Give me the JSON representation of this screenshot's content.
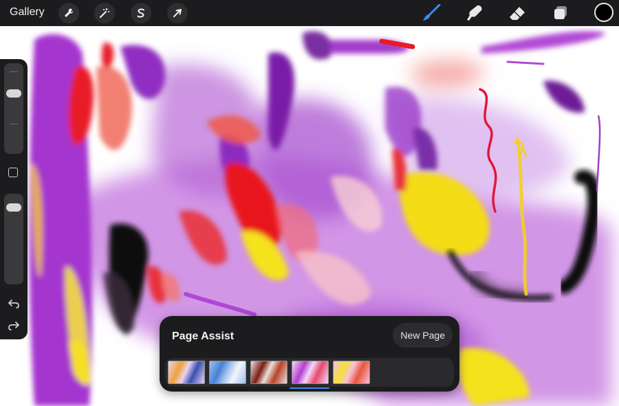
{
  "toolbar": {
    "gallery_label": "Gallery",
    "actions_icon": "wrench-icon",
    "adjustments_icon": "magic-wand-icon",
    "selection_icon": "selection-s-icon",
    "transform_icon": "arrow-cursor-icon",
    "brush_icon": "paintbrush-icon",
    "smudge_icon": "smudge-finger-icon",
    "eraser_icon": "eraser-icon",
    "layers_icon": "layers-icon",
    "active_color": "#000000",
    "active_tool_color": "#3a8df5"
  },
  "sidebar": {
    "brush_size_level": 0.6,
    "opacity_level": 0.92,
    "modify_icon": "square-icon",
    "undo_icon": "undo-arrow-icon",
    "redo_icon": "redo-arrow-icon"
  },
  "page_assist": {
    "title": "Page Assist",
    "new_page_label": "New Page",
    "pages": [
      {
        "name": "page-1",
        "colors": [
          "#f0a13a",
          "#3c4fb0",
          "#e9d3f0"
        ],
        "selected": false
      },
      {
        "name": "page-2",
        "colors": [
          "#4a7fd6",
          "#f2f6fc",
          "#9fc0ee"
        ],
        "selected": false
      },
      {
        "name": "page-3",
        "colors": [
          "#7a1e14",
          "#b8432a",
          "#e9e0da"
        ],
        "selected": false
      },
      {
        "name": "page-4",
        "colors": [
          "#b53fd0",
          "#e54a6e",
          "#f4d8f7"
        ],
        "selected": true
      },
      {
        "name": "page-5",
        "colors": [
          "#f5e03a",
          "#e8563c",
          "#f5c2d8"
        ],
        "selected": false
      }
    ]
  }
}
